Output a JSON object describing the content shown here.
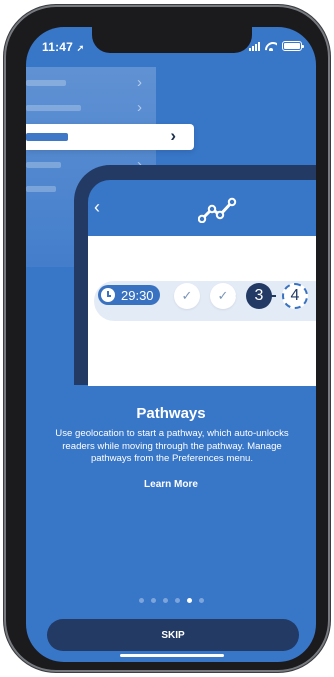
{
  "status_bar": {
    "time": "11:47",
    "location_icon": "location-arrow-icon",
    "icons": [
      "cellular-signal-icon",
      "wifi-icon",
      "battery-icon"
    ]
  },
  "illustration": {
    "back_icon": "chevron-left-icon",
    "logo_icon": "pathway-route-icon",
    "timer": "29:30",
    "steps": [
      {
        "state": "completed",
        "icon": "checkmark-icon"
      },
      {
        "state": "completed",
        "icon": "checkmark-icon"
      },
      {
        "state": "current",
        "label": "3"
      },
      {
        "state": "upcoming",
        "label": "4"
      }
    ]
  },
  "onboarding": {
    "title": "Pathways",
    "description": "Use geolocation to start a pathway, which auto-unlocks readers while moving through the pathway. Manage pathways from the Preferences menu.",
    "learn_more": "Learn More",
    "page_count": 6,
    "active_page": 5
  },
  "footer": {
    "skip_label": "SKIP"
  },
  "colors": {
    "background": "#3876c8",
    "dark_navy": "#223a64",
    "white": "#ffffff"
  }
}
